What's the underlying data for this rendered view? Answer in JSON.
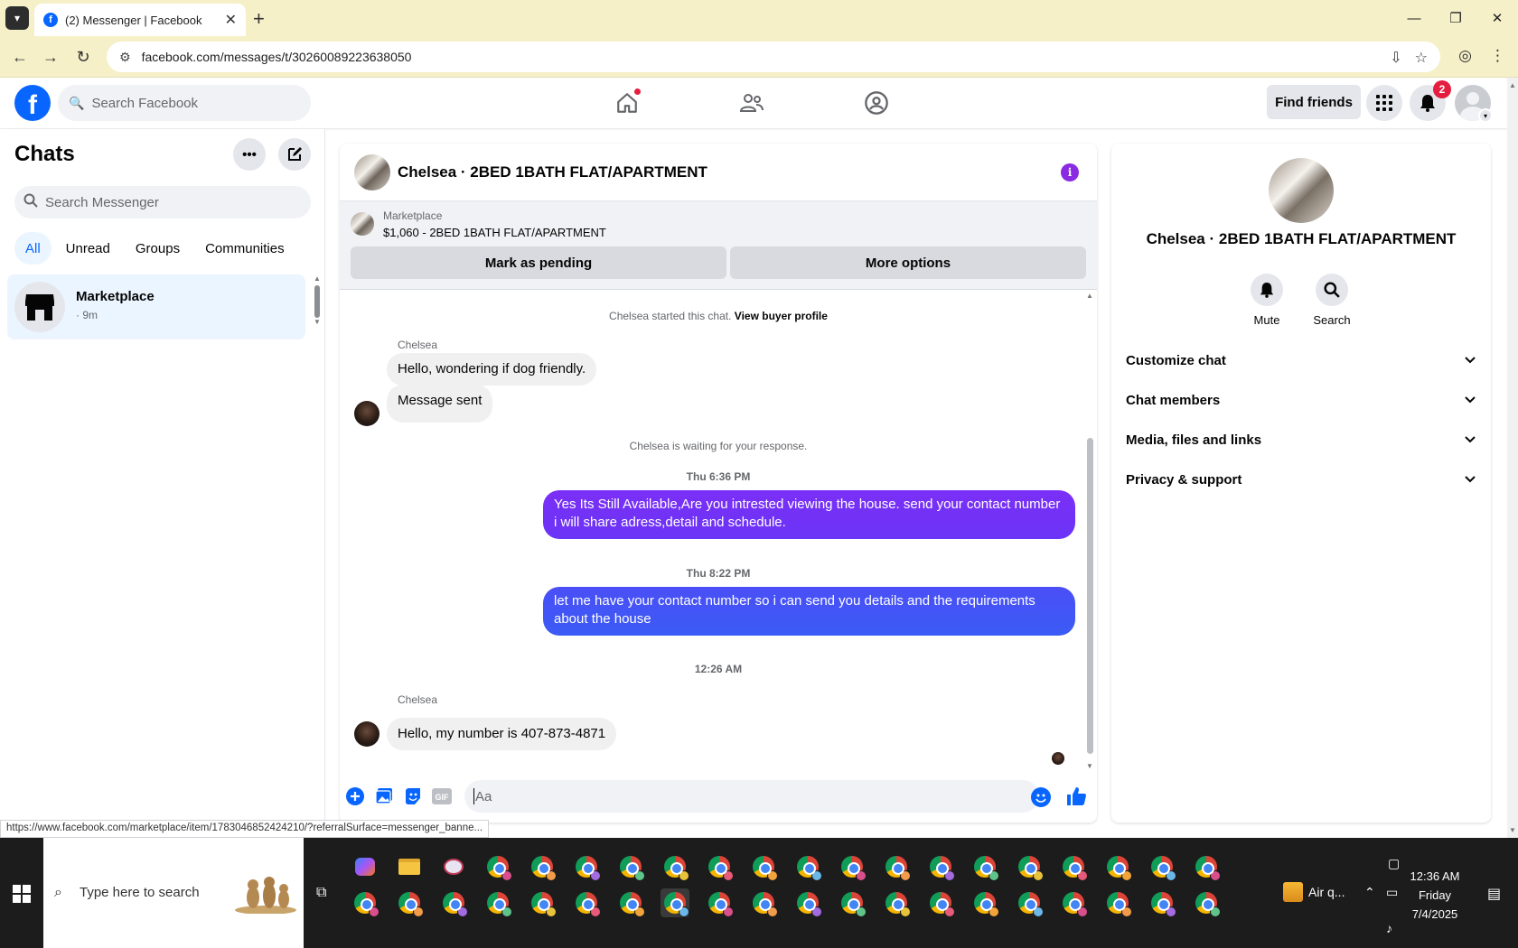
{
  "browser": {
    "tab_title": "(2) Messenger | Facebook",
    "url": "facebook.com/messages/t/30260089223638050",
    "status_url": "https://www.facebook.com/marketplace/item/1783046852424210/?referralSurface=messenger_banne..."
  },
  "fb_header": {
    "search_placeholder": "Search Facebook",
    "find_friends": "Find friends",
    "notification_count": "2"
  },
  "chats": {
    "title": "Chats",
    "search_placeholder": "Search Messenger",
    "filters": [
      "All",
      "Unread",
      "Groups",
      "Communities"
    ],
    "active_filter": "All",
    "items": [
      {
        "name": "Marketplace",
        "time": "· 9m"
      }
    ]
  },
  "conversation": {
    "title": "Chelsea · 2BED 1BATH FLAT/APARTMENT",
    "marketplace_label": "Marketplace",
    "listing": "$1,060 - 2BED 1BATH FLAT/APARTMENT",
    "mark_pending": "Mark as pending",
    "more_options": "More options",
    "started_text": "Chelsea started this chat.",
    "view_buyer": "View buyer profile",
    "waiting_text": "Chelsea is waiting for your response.",
    "messages": [
      {
        "sender": "Chelsea",
        "text": "Hello, wondering if dog friendly."
      },
      {
        "text": "Message sent"
      },
      {
        "time": "Thu 6:36 PM",
        "text": "Yes Its Still Available,Are you intrested viewing the house. send your contact number i will share adress,detail and schedule."
      },
      {
        "time": "Thu 8:22 PM",
        "text": "let me have your contact number so i can send you details and the requirements about the house"
      },
      {
        "time": "12:26 AM",
        "sender": "Chelsea",
        "text": "Hello, my number is 407-873-4871"
      }
    ],
    "composer_placeholder": "Aa"
  },
  "info_panel": {
    "name": "Chelsea · 2BED 1BATH FLAT/APARTMENT",
    "actions": [
      "Mute",
      "Search"
    ],
    "sections": [
      "Customize chat",
      "Chat members",
      "Media, files and links",
      "Privacy & support"
    ]
  },
  "taskbar": {
    "search_placeholder": "Type here to search",
    "weather": "Air q...",
    "time": "12:36 AM",
    "day": "Friday",
    "date": "7/4/2025"
  },
  "colors": {
    "fb_blue": "#0866ff",
    "bubble_out_top": "#7b2ff7",
    "bubble_out_bottom": "#3b5bf5",
    "badge_red": "#e41e3f"
  }
}
